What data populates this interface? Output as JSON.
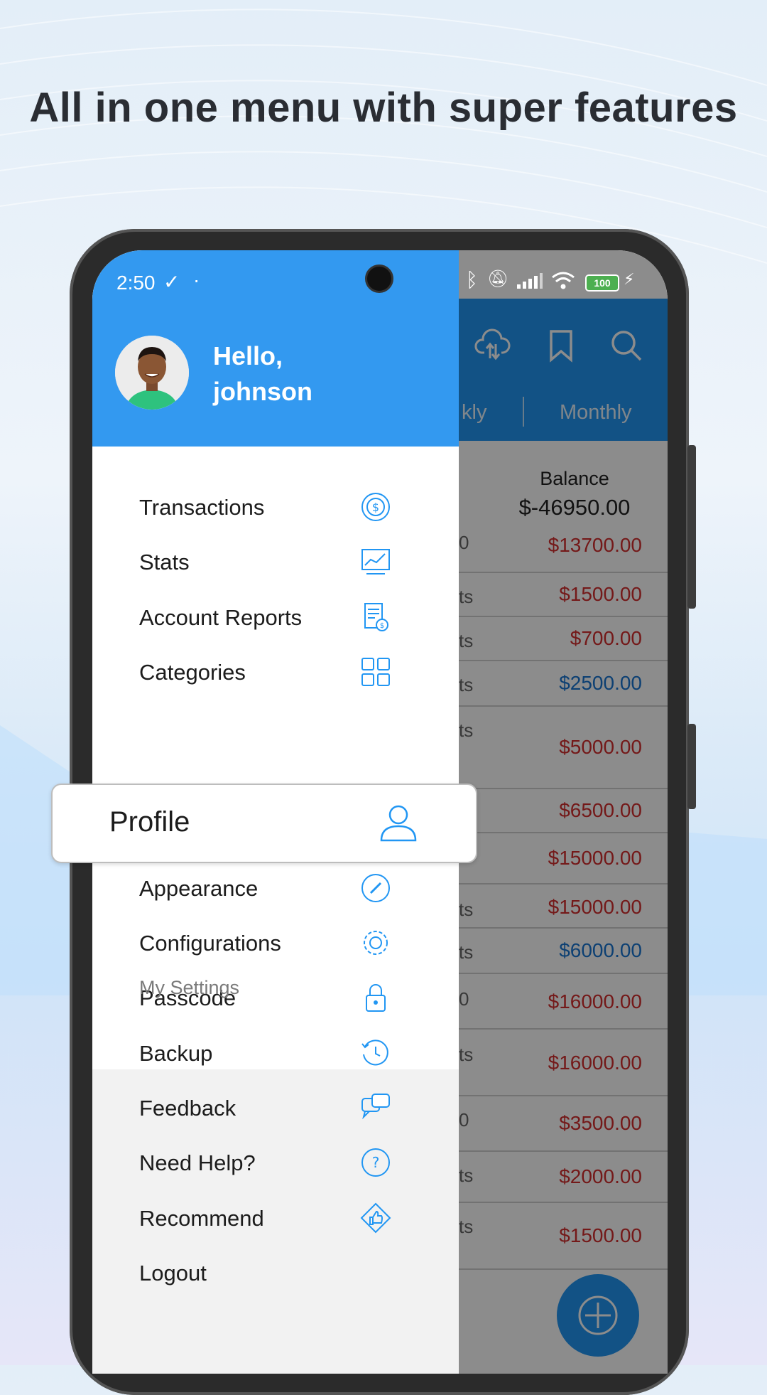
{
  "headline": "All in one menu with super features",
  "status_bar": {
    "time": "2:50",
    "battery": "100"
  },
  "drawer": {
    "greeting_line1": "Hello,",
    "greeting_line2": "johnson",
    "main_items": [
      {
        "label": "Transactions",
        "icon": "dollar-refresh-icon"
      },
      {
        "label": "Stats",
        "icon": "chart-board-icon"
      },
      {
        "label": "Account Reports",
        "icon": "report-icon"
      },
      {
        "label": "Categories",
        "icon": "grid-icon"
      }
    ],
    "settings_header": "My Settings",
    "profile_label": "Profile",
    "settings_items": [
      {
        "label": "Appearance",
        "icon": "brush-icon"
      },
      {
        "label": "Configurations",
        "icon": "gear-icon"
      },
      {
        "label": "Passcode",
        "icon": "lock-icon"
      },
      {
        "label": "Backup",
        "icon": "history-icon"
      }
    ],
    "other_items": [
      {
        "label": "Feedback",
        "icon": "chat-bubbles-icon"
      },
      {
        "label": "Need Help?",
        "icon": "help-icon"
      },
      {
        "label": "Recommend",
        "icon": "thumbs-up-icon"
      },
      {
        "label": "Logout",
        "icon": ""
      }
    ]
  },
  "background_app": {
    "tabs": [
      "kly",
      "Monthly"
    ],
    "balance_label": "Balance",
    "balance_value": "$-46950.00",
    "rows": [
      {
        "label": "0",
        "amount": "$13700.00",
        "color": "red"
      },
      {
        "label": "ts",
        "amount": "$1500.00",
        "color": "red"
      },
      {
        "label": "ts",
        "amount": "$700.00",
        "color": "red"
      },
      {
        "label": "ts",
        "amount": "$2500.00",
        "color": "blue"
      },
      {
        "label": "ts",
        "amount": "$5000.00",
        "color": "red"
      },
      {
        "label": "",
        "amount": "$6500.00",
        "color": "red"
      },
      {
        "label": "",
        "amount": "$15000.00",
        "color": "red"
      },
      {
        "label": "ts",
        "amount": "$15000.00",
        "color": "red"
      },
      {
        "label": "ts",
        "amount": "$6000.00",
        "color": "blue"
      },
      {
        "label": "0",
        "amount": "$16000.00",
        "color": "red"
      },
      {
        "label": "ts",
        "amount": "$16000.00",
        "color": "red"
      },
      {
        "label": "0",
        "amount": "$3500.00",
        "color": "red"
      },
      {
        "label": "ts",
        "amount": "$2000.00",
        "color": "red"
      },
      {
        "label": "ts",
        "amount": "$1500.00",
        "color": "red"
      }
    ]
  },
  "colors": {
    "accent": "#3399f0",
    "expense": "#d32f2f",
    "income": "#1976d2"
  }
}
